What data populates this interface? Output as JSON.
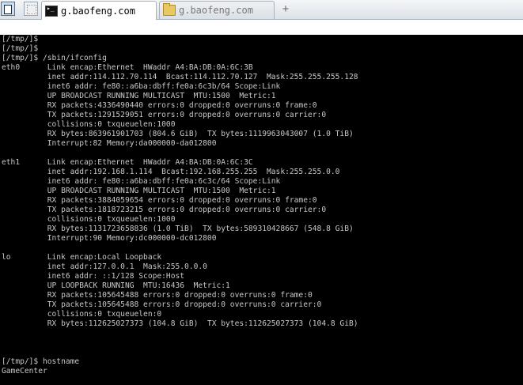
{
  "tabbar": {
    "tabs": [
      {
        "label": "g.baofeng.com",
        "icon": "terminal-icon",
        "active": true
      },
      {
        "label": "g.baofeng.com",
        "icon": "folder-icon",
        "active": false
      }
    ],
    "new_tab_label": "+"
  },
  "terminal": {
    "lines": [
      "[/tmp/]$",
      "[/tmp/]$",
      "[/tmp/]$ /sbin/ifconfig",
      "eth0      Link encap:Ethernet  HWaddr A4:BA:DB:0A:6C:3B",
      "          inet addr:114.112.70.114  Bcast:114.112.70.127  Mask:255.255.255.128",
      "          inet6 addr: fe80::a6ba:dbff:fe0a:6c3b/64 Scope:Link",
      "          UP BROADCAST RUNNING MULTICAST  MTU:1500  Metric:1",
      "          RX packets:4336490440 errors:0 dropped:0 overruns:0 frame:0",
      "          TX packets:1291529051 errors:0 dropped:0 overruns:0 carrier:0",
      "          collisions:0 txqueuelen:1000",
      "          RX bytes:863961901703 (804.6 GiB)  TX bytes:1119963043007 (1.0 TiB)",
      "          Interrupt:82 Memory:da000000-da012800",
      "",
      "eth1      Link encap:Ethernet  HWaddr A4:BA:DB:0A:6C:3C",
      "          inet addr:192.168.1.114  Bcast:192.168.255.255  Mask:255.255.0.0",
      "          inet6 addr: fe80::a6ba:dbff:fe0a:6c3c/64 Scope:Link",
      "          UP BROADCAST RUNNING MULTICAST  MTU:1500  Metric:1",
      "          RX packets:3884059654 errors:0 dropped:0 overruns:0 frame:0",
      "          TX packets:1818723215 errors:0 dropped:0 overruns:0 carrier:0",
      "          collisions:0 txqueuelen:1000",
      "          RX bytes:1131723658836 (1.0 TiB)  TX bytes:589310428667 (548.8 GiB)",
      "          Interrupt:90 Memory:dc000000-dc012800",
      "",
      "lo        Link encap:Local Loopback",
      "          inet addr:127.0.0.1  Mask:255.0.0.0",
      "          inet6 addr: ::1/128 Scope:Host",
      "          UP LOOPBACK RUNNING  MTU:16436  Metric:1",
      "          RX packets:105645488 errors:0 dropped:0 overruns:0 frame:0",
      "          TX packets:105645488 errors:0 dropped:0 overruns:0 carrier:0",
      "          collisions:0 txqueuelen:0",
      "          RX bytes:112625027373 (104.8 GiB)  TX bytes:112625027373 (104.8 GiB)",
      "",
      "",
      "",
      "[/tmp/]$ hostname",
      "GameCenter"
    ]
  }
}
